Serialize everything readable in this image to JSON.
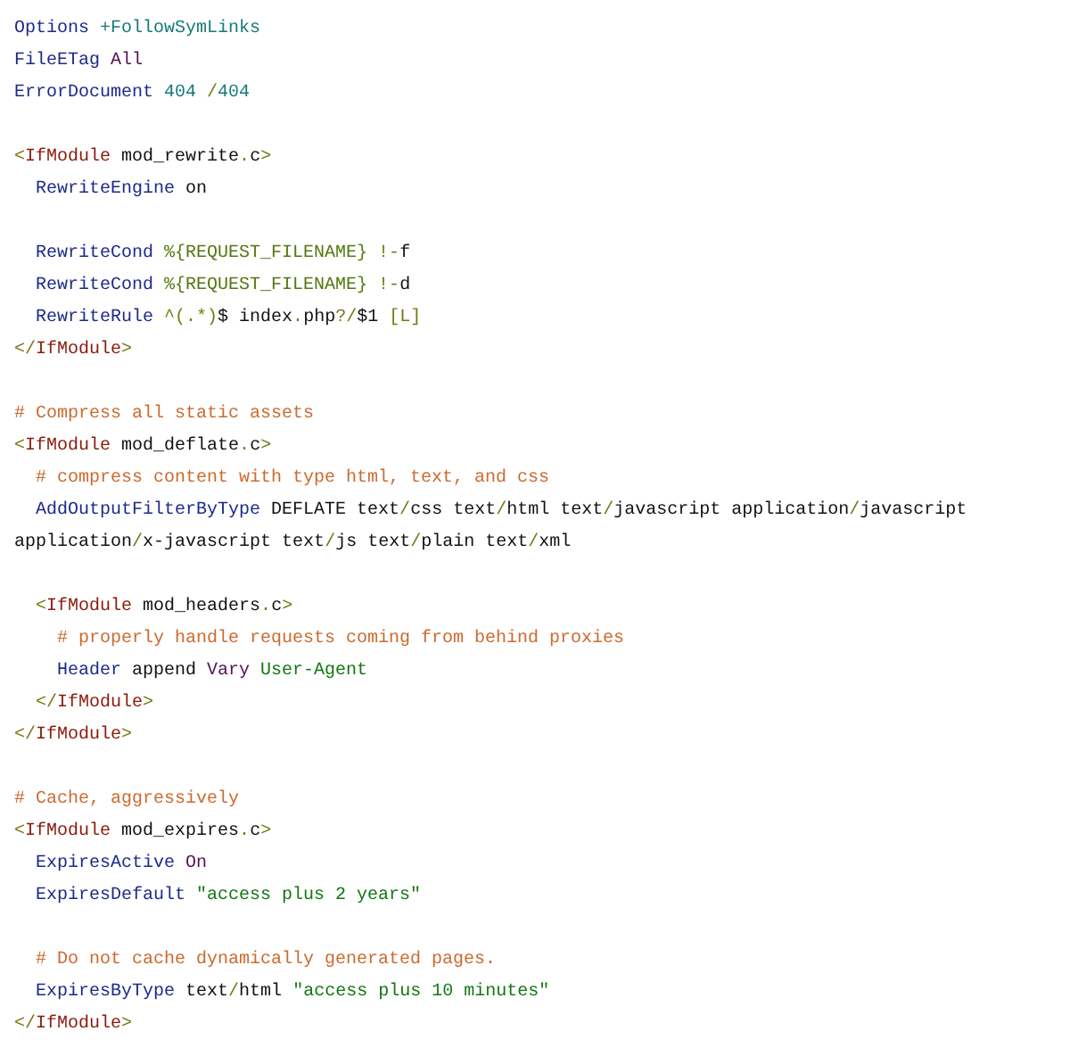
{
  "code_lines": [
    {
      "kind": "code",
      "tokens": [
        {
          "kind": "directive",
          "text": "Options "
        },
        {
          "kind": "value",
          "text": "+FollowSymLinks"
        }
      ]
    },
    {
      "kind": "code",
      "tokens": [
        {
          "kind": "directive",
          "text": "FileETag "
        },
        {
          "kind": "keyword",
          "text": "All"
        }
      ]
    },
    {
      "kind": "code",
      "tokens": [
        {
          "kind": "directive",
          "text": "ErrorDocument "
        },
        {
          "kind": "value",
          "text": "404 "
        },
        {
          "kind": "punct",
          "text": "/"
        },
        {
          "kind": "value",
          "text": "404"
        }
      ]
    },
    {
      "kind": "blank"
    },
    {
      "kind": "code",
      "tokens": [
        {
          "kind": "punct",
          "text": "<"
        },
        {
          "kind": "tag",
          "text": "IfModule "
        },
        {
          "kind": "plain",
          "text": "mod_rewrite"
        },
        {
          "kind": "punct",
          "text": "."
        },
        {
          "kind": "plain",
          "text": "c"
        },
        {
          "kind": "punct",
          "text": ">"
        }
      ],
      "children": [
        {
          "kind": "code",
          "tokens": [
            {
              "kind": "directive",
              "text": "RewriteEngine "
            },
            {
              "kind": "plain",
              "text": "on"
            }
          ]
        },
        {
          "kind": "blank"
        },
        {
          "kind": "code",
          "tokens": [
            {
              "kind": "directive",
              "text": "RewriteCond "
            },
            {
              "kind": "variable",
              "text": "%{REQUEST_FILENAME} "
            },
            {
              "kind": "punct",
              "text": "!-"
            },
            {
              "kind": "plain",
              "text": "f"
            }
          ]
        },
        {
          "kind": "code",
          "tokens": [
            {
              "kind": "directive",
              "text": "RewriteCond "
            },
            {
              "kind": "variable",
              "text": "%{REQUEST_FILENAME} "
            },
            {
              "kind": "punct",
              "text": "!-"
            },
            {
              "kind": "plain",
              "text": "d"
            }
          ]
        },
        {
          "kind": "code",
          "tokens": [
            {
              "kind": "directive",
              "text": "RewriteRule "
            },
            {
              "kind": "punct",
              "text": "^(.*)"
            },
            {
              "kind": "plain",
              "text": "$ index"
            },
            {
              "kind": "punct",
              "text": "."
            },
            {
              "kind": "plain",
              "text": "php"
            },
            {
              "kind": "punct",
              "text": "?/"
            },
            {
              "kind": "plain",
              "text": "$1 "
            },
            {
              "kind": "punct",
              "text": "[L]"
            }
          ]
        }
      ]
    },
    {
      "kind": "code",
      "tokens": [
        {
          "kind": "punct",
          "text": "</"
        },
        {
          "kind": "tag",
          "text": "IfModule"
        },
        {
          "kind": "punct",
          "text": ">"
        }
      ]
    },
    {
      "kind": "blank"
    },
    {
      "kind": "code",
      "tokens": [
        {
          "kind": "comment",
          "text": "# Compress all static assets"
        }
      ]
    },
    {
      "kind": "code",
      "tokens": [
        {
          "kind": "punct",
          "text": "<"
        },
        {
          "kind": "tag",
          "text": "IfModule "
        },
        {
          "kind": "plain",
          "text": "mod_deflate"
        },
        {
          "kind": "punct",
          "text": "."
        },
        {
          "kind": "plain",
          "text": "c"
        },
        {
          "kind": "punct",
          "text": ">"
        }
      ],
      "children": [
        {
          "kind": "code",
          "tokens": [
            {
              "kind": "comment",
              "text": "# compress content with type html, text, and css"
            }
          ]
        },
        {
          "kind": "code",
          "tokens": [
            {
              "kind": "directive",
              "text": "AddOutputFilterByType "
            },
            {
              "kind": "plain",
              "text": "DEFLATE text"
            },
            {
              "kind": "punct",
              "text": "/"
            },
            {
              "kind": "plain",
              "text": "css text"
            },
            {
              "kind": "punct",
              "text": "/"
            },
            {
              "kind": "plain",
              "text": "html text"
            },
            {
              "kind": "punct",
              "text": "/"
            },
            {
              "kind": "plain",
              "text": "javascript application"
            },
            {
              "kind": "punct",
              "text": "/"
            },
            {
              "kind": "plain",
              "text": "javascript"
            }
          ],
          "wrap": [
            {
              "kind": "plain",
              "text": "application"
            },
            {
              "kind": "punct",
              "text": "/"
            },
            {
              "kind": "plain",
              "text": "x-javascript text"
            },
            {
              "kind": "punct",
              "text": "/"
            },
            {
              "kind": "plain",
              "text": "js text"
            },
            {
              "kind": "punct",
              "text": "/"
            },
            {
              "kind": "plain",
              "text": "plain text"
            },
            {
              "kind": "punct",
              "text": "/"
            },
            {
              "kind": "plain",
              "text": "xml"
            }
          ]
        },
        {
          "kind": "blank"
        },
        {
          "kind": "code",
          "tokens": [
            {
              "kind": "punct",
              "text": "<"
            },
            {
              "kind": "tag",
              "text": "IfModule "
            },
            {
              "kind": "plain",
              "text": "mod_headers"
            },
            {
              "kind": "punct",
              "text": "."
            },
            {
              "kind": "plain",
              "text": "c"
            },
            {
              "kind": "punct",
              "text": ">"
            }
          ],
          "children": [
            {
              "kind": "code",
              "tokens": [
                {
                  "kind": "comment",
                  "text": "# properly handle requests coming from behind proxies"
                }
              ]
            },
            {
              "kind": "code",
              "tokens": [
                {
                  "kind": "directive",
                  "text": "Header "
                },
                {
                  "kind": "plain",
                  "text": "append "
                },
                {
                  "kind": "keyword",
                  "text": "Vary "
                },
                {
                  "kind": "string",
                  "text": "User-Agent"
                }
              ]
            }
          ]
        },
        {
          "kind": "code",
          "tokens": [
            {
              "kind": "punct",
              "text": "</"
            },
            {
              "kind": "tag",
              "text": "IfModule"
            },
            {
              "kind": "punct",
              "text": ">"
            }
          ]
        }
      ]
    },
    {
      "kind": "code",
      "tokens": [
        {
          "kind": "punct",
          "text": "</"
        },
        {
          "kind": "tag",
          "text": "IfModule"
        },
        {
          "kind": "punct",
          "text": ">"
        }
      ]
    },
    {
      "kind": "blank"
    },
    {
      "kind": "code",
      "tokens": [
        {
          "kind": "comment",
          "text": "# Cache, aggressively"
        }
      ]
    },
    {
      "kind": "code",
      "tokens": [
        {
          "kind": "punct",
          "text": "<"
        },
        {
          "kind": "tag",
          "text": "IfModule "
        },
        {
          "kind": "plain",
          "text": "mod_expires"
        },
        {
          "kind": "punct",
          "text": "."
        },
        {
          "kind": "plain",
          "text": "c"
        },
        {
          "kind": "punct",
          "text": ">"
        }
      ],
      "children": [
        {
          "kind": "code",
          "tokens": [
            {
              "kind": "directive",
              "text": "ExpiresActive "
            },
            {
              "kind": "keyword",
              "text": "On"
            }
          ]
        },
        {
          "kind": "code",
          "tokens": [
            {
              "kind": "directive",
              "text": "ExpiresDefault "
            },
            {
              "kind": "string",
              "text": "\"access plus 2 years\""
            }
          ]
        },
        {
          "kind": "blank"
        },
        {
          "kind": "code",
          "tokens": [
            {
              "kind": "comment",
              "text": "# Do not cache dynamically generated pages."
            }
          ]
        },
        {
          "kind": "code",
          "tokens": [
            {
              "kind": "directive",
              "text": "ExpiresByType "
            },
            {
              "kind": "plain",
              "text": "text"
            },
            {
              "kind": "punct",
              "text": "/"
            },
            {
              "kind": "plain",
              "text": "html "
            },
            {
              "kind": "string",
              "text": "\"access plus 10 minutes\""
            }
          ]
        }
      ]
    },
    {
      "kind": "code",
      "tokens": [
        {
          "kind": "punct",
          "text": "</"
        },
        {
          "kind": "tag",
          "text": "IfModule"
        },
        {
          "kind": "punct",
          "text": ">"
        }
      ]
    }
  ]
}
